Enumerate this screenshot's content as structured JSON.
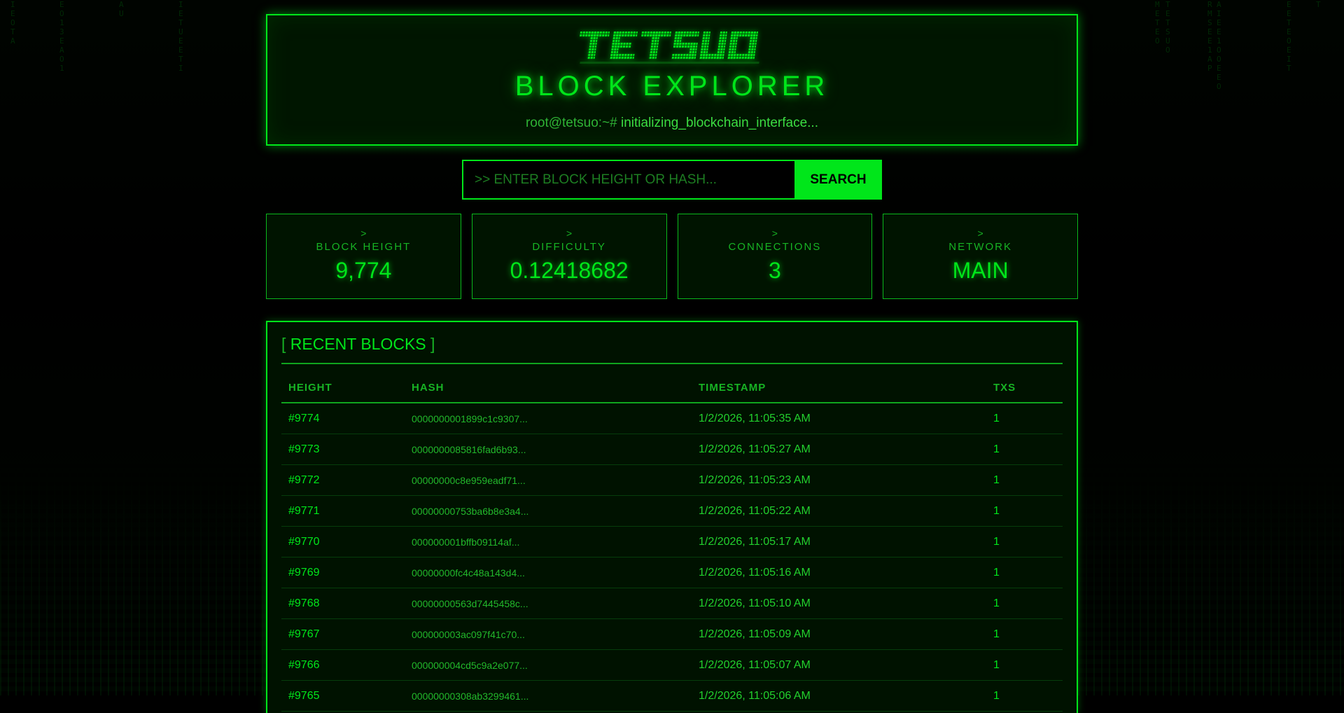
{
  "header": {
    "logo_text": "TETSUO",
    "title": "BLOCK EXPLORER",
    "prompt_user": "root@tetsuo:~#",
    "prompt_command": "initializing_blockchain_interface..."
  },
  "search": {
    "placeholder": ">> ENTER BLOCK HEIGHT OR HASH...",
    "button_label": "SEARCH"
  },
  "stats": [
    {
      "arrow": ">",
      "label": "BLOCK HEIGHT",
      "value": "9,774"
    },
    {
      "arrow": ">",
      "label": "DIFFICULTY",
      "value": "0.12418682"
    },
    {
      "arrow": ">",
      "label": "CONNECTIONS",
      "value": "3"
    },
    {
      "arrow": ">",
      "label": "NETWORK",
      "value": "MAIN"
    }
  ],
  "recent_blocks": {
    "title_open": "[",
    "title": "RECENT BLOCKS",
    "title_close": "]",
    "columns": [
      "HEIGHT",
      "HASH",
      "TIMESTAMP",
      "TXS"
    ],
    "rows": [
      {
        "height": "#9774",
        "hash": "0000000001899c1c9307...",
        "timestamp": "1/2/2026, 11:05:35 AM",
        "txs": "1"
      },
      {
        "height": "#9773",
        "hash": "0000000085816fad6b93...",
        "timestamp": "1/2/2026, 11:05:27 AM",
        "txs": "1"
      },
      {
        "height": "#9772",
        "hash": "00000000c8e959eadf71...",
        "timestamp": "1/2/2026, 11:05:23 AM",
        "txs": "1"
      },
      {
        "height": "#9771",
        "hash": "00000000753ba6b8e3a4...",
        "timestamp": "1/2/2026, 11:05:22 AM",
        "txs": "1"
      },
      {
        "height": "#9770",
        "hash": "000000001bffb09114af...",
        "timestamp": "1/2/2026, 11:05:17 AM",
        "txs": "1"
      },
      {
        "height": "#9769",
        "hash": "00000000fc4c48a143d4...",
        "timestamp": "1/2/2026, 11:05:16 AM",
        "txs": "1"
      },
      {
        "height": "#9768",
        "hash": "00000000563d7445458c...",
        "timestamp": "1/2/2026, 11:05:10 AM",
        "txs": "1"
      },
      {
        "height": "#9767",
        "hash": "000000003ac097f41c70...",
        "timestamp": "1/2/2026, 11:05:09 AM",
        "txs": "1"
      },
      {
        "height": "#9766",
        "hash": "000000004cd5c9a2e077...",
        "timestamp": "1/2/2026, 11:05:07 AM",
        "txs": "1"
      },
      {
        "height": "#9765",
        "hash": "00000000308ab3299461...",
        "timestamp": "1/2/2026, 11:05:06 AM",
        "txs": "1"
      }
    ]
  },
  "theme": {
    "accent": "#00e61a",
    "background": "#000000",
    "panel_bg": "#001400"
  }
}
